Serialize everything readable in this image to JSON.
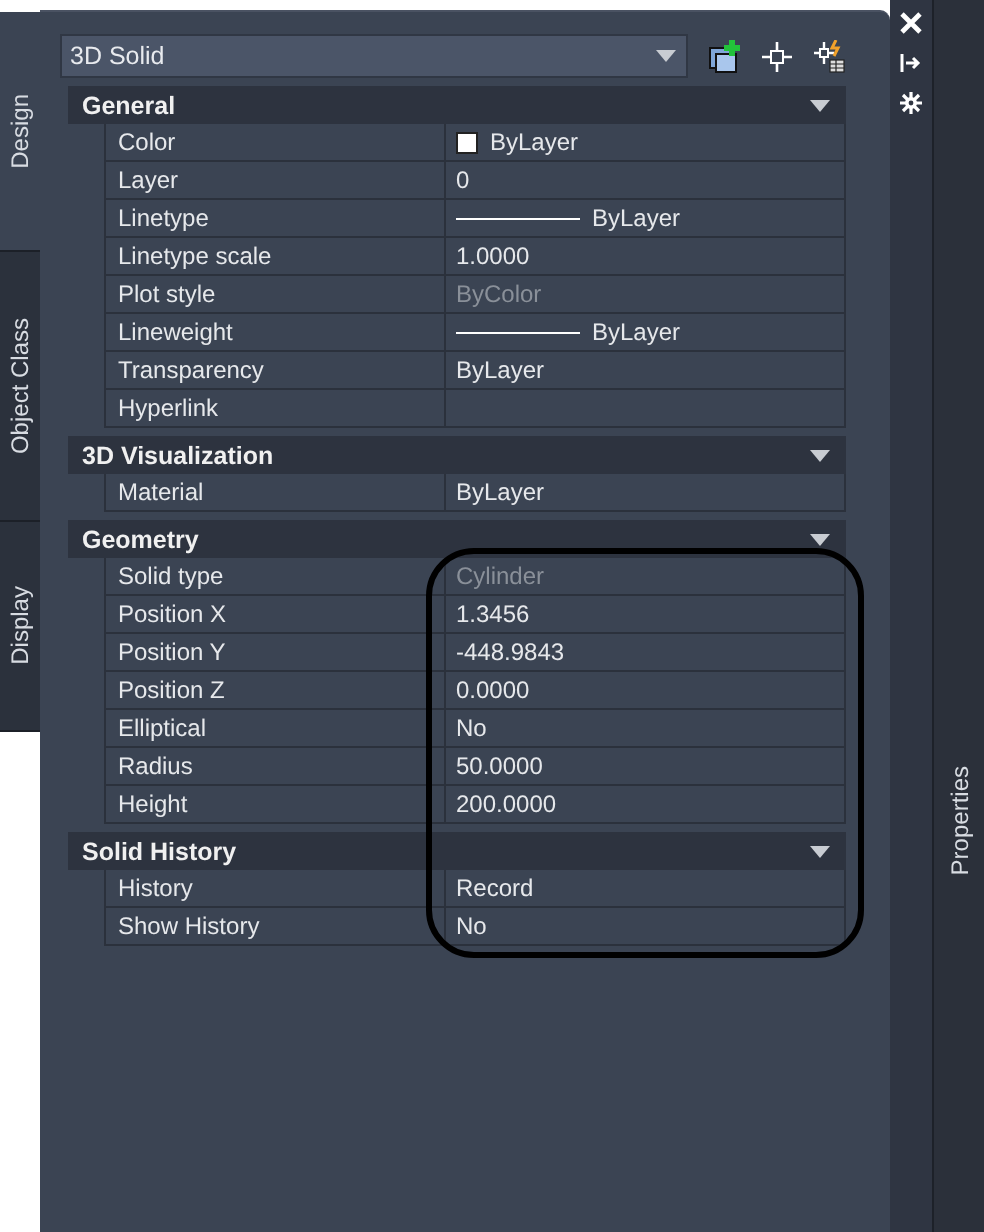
{
  "side_tabs": [
    {
      "label": "Design",
      "selected": true
    },
    {
      "label": "Object Class",
      "selected": false
    },
    {
      "label": "Display",
      "selected": false
    }
  ],
  "object_selector": {
    "value": "3D Solid"
  },
  "sections": [
    {
      "title": "General",
      "expanded": true,
      "rows": [
        {
          "label": "Color",
          "value": "ByLayer",
          "kind": "swatch",
          "disabled": false
        },
        {
          "label": "Layer",
          "value": "0",
          "kind": "text",
          "disabled": false
        },
        {
          "label": "Linetype",
          "value": "ByLayer",
          "kind": "line",
          "disabled": false
        },
        {
          "label": "Linetype scale",
          "value": "1.0000",
          "kind": "text",
          "disabled": false
        },
        {
          "label": "Plot style",
          "value": "ByColor",
          "kind": "text",
          "disabled": true
        },
        {
          "label": "Lineweight",
          "value": "ByLayer",
          "kind": "line",
          "disabled": false
        },
        {
          "label": "Transparency",
          "value": "ByLayer",
          "kind": "text",
          "disabled": false
        },
        {
          "label": "Hyperlink",
          "kind": "text",
          "disabled": false
        }
      ]
    },
    {
      "title": "3D Visualization",
      "expanded": true,
      "rows": [
        {
          "label": "Material",
          "value": "ByLayer",
          "kind": "text",
          "disabled": false
        }
      ]
    },
    {
      "title": "Geometry",
      "expanded": true,
      "rows": [
        {
          "label": "Solid type",
          "value": "Cylinder",
          "kind": "text",
          "disabled": true
        },
        {
          "label": "Position X",
          "value": "1.3456",
          "kind": "text",
          "disabled": false
        },
        {
          "label": "Position Y",
          "value": "-448.9843",
          "kind": "text",
          "disabled": false
        },
        {
          "label": "Position Z",
          "value": "0.0000",
          "kind": "text",
          "disabled": false
        },
        {
          "label": "Elliptical",
          "value": "No",
          "kind": "text",
          "disabled": false
        },
        {
          "label": "Radius",
          "value": "50.0000",
          "kind": "text",
          "disabled": false
        },
        {
          "label": "Height",
          "value": "200.0000",
          "kind": "text",
          "disabled": false
        }
      ]
    },
    {
      "title": "Solid History",
      "expanded": true,
      "rows": [
        {
          "label": "History",
          "value": "Record",
          "kind": "text",
          "disabled": false
        },
        {
          "label": "Show History",
          "value": "No",
          "kind": "text",
          "disabled": false
        }
      ]
    }
  ],
  "palette_title": "Properties"
}
